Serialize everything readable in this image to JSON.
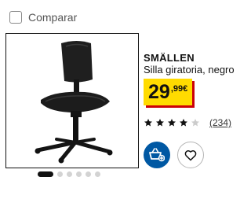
{
  "compare": {
    "label": "Comparar",
    "checked": false
  },
  "product": {
    "name": "SMÄLLEN",
    "description": "Silla giratoria, negro",
    "image_icon": "office-chair-image",
    "price": {
      "integer": "29",
      "decimal": ",99",
      "currency": "€"
    },
    "rating": {
      "stars": 4,
      "max": 5,
      "reviews": "(234)"
    }
  },
  "carousel": {
    "count": 6,
    "active": 1
  },
  "actions": {
    "cart_icon": "add-to-cart-icon",
    "favorite_icon": "heart-icon"
  },
  "colors": {
    "price_bg": "#ffdb00",
    "price_shadow": "#cc0008",
    "cart_button": "#0058a3",
    "star": "#111111",
    "star_empty": "#cccccc"
  }
}
